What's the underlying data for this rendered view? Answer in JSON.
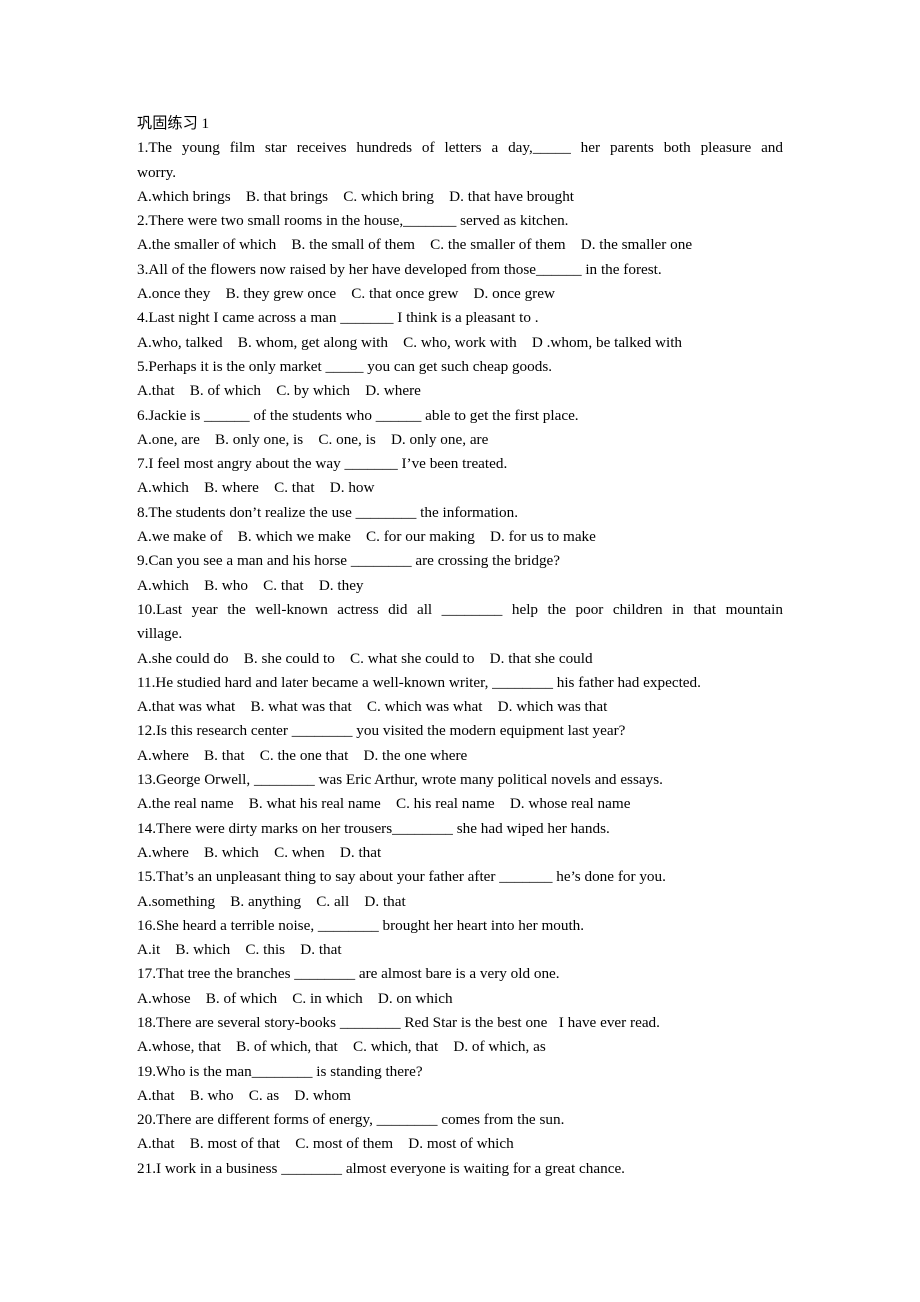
{
  "document": {
    "title": "巩固练习 1",
    "language_note": "English grammar multiple-choice worksheet (relative clauses)",
    "page_background": "#ffffff",
    "text_color": "#000000"
  },
  "blanks": {
    "short": "_____",
    "medium": "_______",
    "long": "________",
    "xlong": "_________"
  },
  "items": [
    {
      "number": "1.",
      "stem": "The  young  film  star  receives  hundreds  of  letters  a  day,_____  her  parents  both  pleasure  and worry.",
      "options": "A.which brings    B. that brings    C. which bring    D. that have brought"
    },
    {
      "number": "2.",
      "stem": "There were two small rooms in the house,_______ served as kitchen.",
      "options": "A.the smaller of which    B. the small of them    C. the smaller of them    D. the smaller one"
    },
    {
      "number": "3.",
      "stem": "All of the flowers now raised by her have developed from those______ in the forest.",
      "options": "A.once they    B. they grew once    C. that once grew    D. once grew"
    },
    {
      "number": "4.",
      "stem": "Last night I came across a man _______ I think is a pleasant to .",
      "options": "A.who, talked    B. whom, get along with    C. who, work with    D .whom, be talked with"
    },
    {
      "number": "5.",
      "stem": "Perhaps it is the only market _____ you can get such cheap goods.",
      "options": "A.that    B. of which    C. by which    D. where"
    },
    {
      "number": "6.",
      "stem": "Jackie is ______ of the students who ______ able to get the first place.",
      "options": "A.one, are    B. only one, is    C. one, is    D. only one, are"
    },
    {
      "number": "7.",
      "stem": "I feel most angry about the way _______ I’ve been treated.",
      "options": "A.which    B. where    C. that    D. how"
    },
    {
      "number": "8.",
      "stem": "The students don’t realize the use ________ the information.",
      "options": "A.we make of    B. which we make    C. for our making    D. for us to make"
    },
    {
      "number": "9.",
      "stem": "Can you see a man and his horse ________ are crossing the bridge?",
      "options": "A.which    B. who    C. that    D. they"
    },
    {
      "number": "10.",
      "stem": "Last  year  the  well-known  actress  did  all  ________  help  the  poor  children  in  that  mountain village.",
      "options": "A.she could do    B. she could to    C. what she could to    D. that she could"
    },
    {
      "number": "11.",
      "stem": "He studied hard and later became a well-known writer, ________ his father had expected.",
      "options": "A.that was what    B. what was that    C. which was what    D. which was that"
    },
    {
      "number": "12.",
      "stem": "Is this research center ________ you visited the modern equipment last year?",
      "options": "A.where    B. that    C. the one that    D. the one where"
    },
    {
      "number": "13.",
      "stem": "George Orwell, ________ was Eric Arthur, wrote many political novels and essays.",
      "options": "A.the real name    B. what his real name    C. his real name    D. whose real name"
    },
    {
      "number": "14.",
      "stem": "There were dirty marks on her trousers________ she had wiped her hands.",
      "options": "A.where    B. which    C. when    D. that"
    },
    {
      "number": "15.",
      "stem": "That’s an unpleasant thing to say about your father after _______ he’s done for you.",
      "options": "A.something    B. anything    C. all    D. that"
    },
    {
      "number": "16.",
      "stem": "She heard a terrible noise, ________ brought her heart into her mouth.",
      "options": "A.it    B. which    C. this    D. that"
    },
    {
      "number": "17.",
      "stem": "That tree the branches ________ are almost bare is a very old one.",
      "options": "A.whose    B. of which    C. in which    D. on which"
    },
    {
      "number": "18.",
      "stem": "There are several story-books ________ Red Star is the best one   I have ever read.",
      "options": "A.whose, that    B. of which, that    C. which, that    D. of which, as"
    },
    {
      "number": "19.",
      "stem": "Who is the man________ is standing there?",
      "options": "A.that    B. who    C. as    D. whom"
    },
    {
      "number": "20.",
      "stem": "There are different forms of energy, ________ comes from the sun.",
      "options": "A.that    B. most of that    C. most of them    D. most of which"
    },
    {
      "number": "21.",
      "stem": "I work in a business ________ almost everyone is waiting for a great chance.",
      "options": null
    }
  ]
}
